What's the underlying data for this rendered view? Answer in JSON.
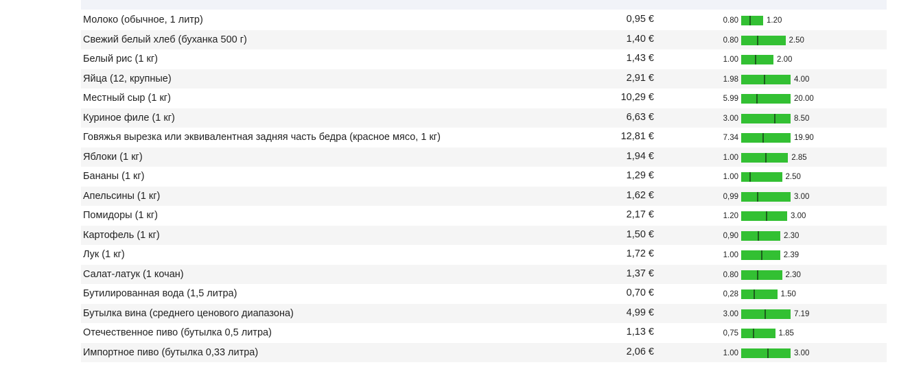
{
  "currency_symbol": "€",
  "colors": {
    "range_bar": "#33c033",
    "range_marker": "#1c5e1c",
    "stripe": "#f5f5f5"
  },
  "items": [
    {
      "name": "Молоко (обычное, 1 литр)",
      "price": "0,95 €",
      "min": "0.80",
      "max": "1.20",
      "avg": 0.95
    },
    {
      "name": "Свежий белый хлеб (буханка 500 г)",
      "price": "1,40 €",
      "min": "0.80",
      "max": "2.50",
      "avg": 1.4
    },
    {
      "name": "Белый рис (1 кг)",
      "price": "1,43 €",
      "min": "1.00",
      "max": "2.00",
      "avg": 1.43
    },
    {
      "name": "Яйца (12, крупные)",
      "price": "2,91 €",
      "min": "1.98",
      "max": "4.00",
      "avg": 2.91
    },
    {
      "name": "Местный сыр (1 кг)",
      "price": "10,29 €",
      "min": "5.99",
      "max": "20.00",
      "avg": 10.29
    },
    {
      "name": "Куриное филе (1 кг)",
      "price": "6,63 €",
      "min": "3.00",
      "max": "8.50",
      "avg": 6.63
    },
    {
      "name": "Говяжья вырезка или эквивалентная задняя часть бедра (красное мясо, 1 кг)",
      "price": "12,81 €",
      "min": "7.34",
      "max": "19.90",
      "avg": 12.81
    },
    {
      "name": "Яблоки (1 кг)",
      "price": "1,94 €",
      "min": "1.00",
      "max": "2.85",
      "avg": 1.94
    },
    {
      "name": "Бананы (1 кг)",
      "price": "1,29 €",
      "min": "1.00",
      "max": "2.50",
      "avg": 1.29
    },
    {
      "name": "Апельсины (1 кг)",
      "price": "1,62 €",
      "min": "0,99",
      "max": "3.00",
      "avg": 1.62
    },
    {
      "name": "Помидоры (1 кг)",
      "price": "2,17 €",
      "min": "1.20",
      "max": "3.00",
      "avg": 2.17
    },
    {
      "name": "Картофель (1 кг)",
      "price": "1,50 €",
      "min": "0,90",
      "max": "2.30",
      "avg": 1.5
    },
    {
      "name": "Лук (1 кг)",
      "price": "1,72 €",
      "min": "1.00",
      "max": "2.39",
      "avg": 1.72
    },
    {
      "name": "Салат-латук (1 кочан)",
      "price": "1,37 €",
      "min": "0.80",
      "max": "2.30",
      "avg": 1.37
    },
    {
      "name": "Бутилированная вода (1,5 литра)",
      "price": "0,70 €",
      "min": "0,28",
      "max": "1.50",
      "avg": 0.7
    },
    {
      "name": "Бутылка вина (среднего ценового диапазона)",
      "price": "4,99 €",
      "min": "3.00",
      "max": "7.19",
      "avg": 4.99
    },
    {
      "name": "Отечественное пиво (бутылка 0,5 литра)",
      "price": "1,13 €",
      "min": "0,75",
      "max": "1.85",
      "avg": 1.13
    },
    {
      "name": "Импортное пиво (бутылка 0,33 литра)",
      "price": "2,06 €",
      "min": "1.00",
      "max": "3.00",
      "avg": 2.06
    }
  ]
}
